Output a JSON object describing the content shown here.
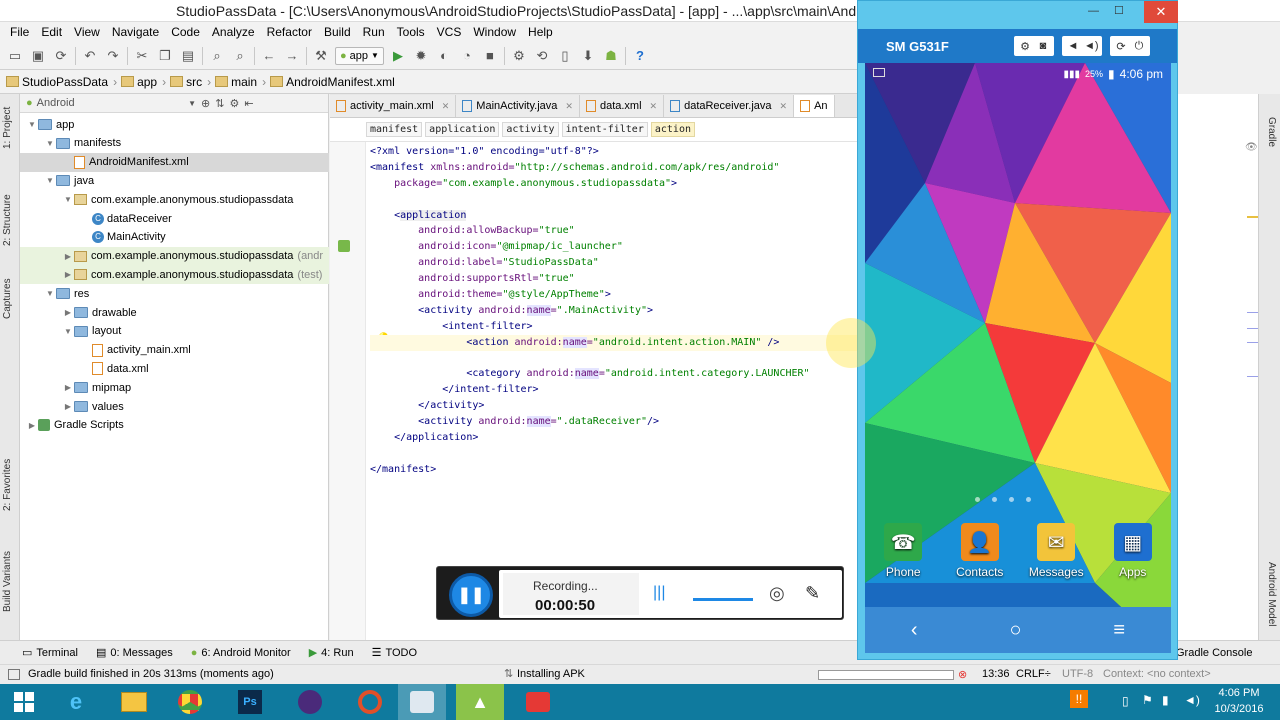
{
  "window": {
    "title": "StudioPassData - [C:\\Users\\Anonymous\\AndroidStudioProjects\\StudioPassData] - [app] - ...\\app\\src\\main\\AndroidManifest.xml",
    "minimize": "—",
    "maximize": "☐",
    "close": "✕"
  },
  "menu": [
    "File",
    "Edit",
    "View",
    "Navigate",
    "Code",
    "Analyze",
    "Refactor",
    "Build",
    "Run",
    "Tools",
    "VCS",
    "Window",
    "Help"
  ],
  "toolbar": {
    "run_config": "app",
    "help": "?"
  },
  "breadcrumbs": [
    "StudioPassData",
    "app",
    "src",
    "main",
    "AndroidManifest.xml"
  ],
  "left_tabs": [
    "1: Project",
    "2: Structure",
    "Captures",
    "2: Favorites",
    "Build Variants"
  ],
  "project": {
    "view": "Android",
    "tree": [
      {
        "label": "app",
        "depth": 0,
        "kind": "folder",
        "open": true
      },
      {
        "label": "manifests",
        "depth": 1,
        "kind": "folder",
        "open": true
      },
      {
        "label": "AndroidManifest.xml",
        "depth": 2,
        "kind": "xml",
        "selected": true
      },
      {
        "label": "java",
        "depth": 1,
        "kind": "folder",
        "open": true
      },
      {
        "label": "com.example.anonymous.studiopassdata",
        "depth": 2,
        "kind": "pkg",
        "open": true
      },
      {
        "label": "dataReceiver",
        "depth": 3,
        "kind": "class"
      },
      {
        "label": "MainActivity",
        "depth": 3,
        "kind": "class"
      },
      {
        "label": "com.example.anonymous.studiopassdata",
        "suffix": "(andr",
        "depth": 2,
        "kind": "pkg",
        "hl": true
      },
      {
        "label": "com.example.anonymous.studiopassdata",
        "suffix": "(test)",
        "depth": 2,
        "kind": "pkg",
        "hl": true
      },
      {
        "label": "res",
        "depth": 1,
        "kind": "folder",
        "open": true
      },
      {
        "label": "drawable",
        "depth": 2,
        "kind": "folder"
      },
      {
        "label": "layout",
        "depth": 2,
        "kind": "folder",
        "open": true
      },
      {
        "label": "activity_main.xml",
        "depth": 3,
        "kind": "xml"
      },
      {
        "label": "data.xml",
        "depth": 3,
        "kind": "xml"
      },
      {
        "label": "mipmap",
        "depth": 2,
        "kind": "folder"
      },
      {
        "label": "values",
        "depth": 2,
        "kind": "folder"
      },
      {
        "label": "Gradle Scripts",
        "depth": 0,
        "kind": "gradle"
      }
    ]
  },
  "editor": {
    "tabs": [
      "activity_main.xml",
      "MainActivity.java",
      "data.xml",
      "dataReceiver.java",
      "An"
    ],
    "active_tab": 4,
    "tag_crumbs": [
      "manifest",
      "application",
      "activity",
      "intent-filter",
      "action"
    ],
    "lines": [
      [
        [
          "t",
          "<?xml version=\"1.0\" encoding=\"utf-8\"?>"
        ]
      ],
      [
        [
          "t",
          "<manifest "
        ],
        [
          "a",
          "xmlns:android="
        ],
        [
          "v",
          "\"http://schemas.android.com/apk/res/android\""
        ]
      ],
      [
        [
          "a",
          "    package="
        ],
        [
          "v",
          "\"com.example.anonymous.studiopassdata\""
        ],
        [
          "t",
          ">"
        ]
      ],
      [
        [
          "t",
          ""
        ]
      ],
      [
        [
          "t",
          "    <"
        ],
        [
          "tn",
          "application"
        ]
      ],
      [
        [
          "a",
          "        android:allowBackup="
        ],
        [
          "v",
          "\"true\""
        ]
      ],
      [
        [
          "a",
          "        android:icon="
        ],
        [
          "v",
          "\"@mipmap/ic_launcher\""
        ]
      ],
      [
        [
          "a",
          "        android:label="
        ],
        [
          "v",
          "\"StudioPassData\""
        ]
      ],
      [
        [
          "a",
          "        android:supportsRtl="
        ],
        [
          "v",
          "\"true\""
        ]
      ],
      [
        [
          "a",
          "        android:theme="
        ],
        [
          "v",
          "\"@style/AppTheme\""
        ],
        [
          "t",
          ">"
        ]
      ],
      [
        [
          "t",
          "        <activity "
        ],
        [
          "a",
          "android:"
        ],
        [
          "nm",
          "name"
        ],
        [
          "a",
          "="
        ],
        [
          "v",
          "\".MainActivity\""
        ],
        [
          "t",
          ">"
        ]
      ],
      [
        [
          "t",
          "            <intent-filter>"
        ]
      ],
      [
        [
          "t",
          "                <action "
        ],
        [
          "a",
          "android:"
        ],
        [
          "nm",
          "name"
        ],
        [
          "a",
          "="
        ],
        [
          "v",
          "\"android.intent.action.MAIN\""
        ],
        [
          "t",
          " />"
        ]
      ],
      [
        [
          "t",
          ""
        ]
      ],
      [
        [
          "t",
          "                <category "
        ],
        [
          "a",
          "android:"
        ],
        [
          "nm",
          "name"
        ],
        [
          "a",
          "="
        ],
        [
          "v",
          "\"android.intent.category.LAUNCHER\""
        ]
      ],
      [
        [
          "t",
          "            </intent-filter>"
        ]
      ],
      [
        [
          "t",
          "        </activity>"
        ]
      ],
      [
        [
          "t",
          "        <activity "
        ],
        [
          "a",
          "android:"
        ],
        [
          "nm",
          "name"
        ],
        [
          "a",
          "="
        ],
        [
          "v",
          "\".dataReceiver\""
        ],
        [
          "t",
          "/>"
        ]
      ],
      [
        [
          "t",
          "    </application>"
        ]
      ],
      [
        [
          "t",
          ""
        ]
      ],
      [
        [
          "t",
          "</manifest>"
        ]
      ]
    ],
    "current_line": 12
  },
  "right_tabs": [
    "Gradle",
    "Android Model"
  ],
  "bottom_tabs": [
    "Terminal",
    "0: Messages",
    "6: Android Monitor",
    "4: Run",
    "TODO",
    "Gradle Console"
  ],
  "status": {
    "message": "Gradle build finished in 20s 313ms (moments ago)",
    "task": "Installing APK",
    "line_col": "13:36",
    "line_sep": "CRLF÷",
    "encoding": "UTF-8",
    "context": "Context: <no context>"
  },
  "phone": {
    "device": "SM G531F",
    "time": "4:06 pm",
    "battery": "25%",
    "apps": [
      {
        "label": "Phone",
        "color": "#2ea84a"
      },
      {
        "label": "Contacts",
        "color": "#f08a1c"
      },
      {
        "label": "Messages",
        "color": "#f2c43a"
      },
      {
        "label": "Apps",
        "color": "#1e6fd0"
      }
    ],
    "nav": [
      "‹",
      "○",
      "≡"
    ]
  },
  "recorder": {
    "state": "Recording...",
    "time": "00:00:50"
  },
  "clock": {
    "time": "4:06 PM",
    "date": "10/3/2016"
  }
}
